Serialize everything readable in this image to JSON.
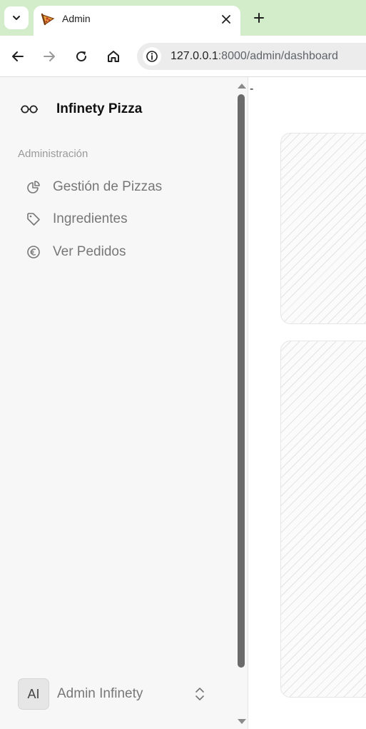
{
  "browser": {
    "tab_title": "Admin",
    "url_host": "127.0.0.1",
    "url_rest": ":8000/admin/dashboard",
    "icons": [
      "chevron-down-icon",
      "pizza-favicon",
      "close-icon",
      "plus-icon",
      "back-icon",
      "forward-icon",
      "reload-icon",
      "home-icon",
      "info-icon"
    ]
  },
  "sidebar": {
    "brand": "Infinety Pizza",
    "section_label": "Administración",
    "items": [
      {
        "label": "Gestión de Pizzas",
        "icon": "pie-chart-icon"
      },
      {
        "label": "Ingredientes",
        "icon": "tag-icon"
      },
      {
        "label": "Ver Pedidos",
        "icon": "euro-icon"
      }
    ],
    "user": {
      "initials": "AI",
      "name": "Admin Infinety"
    }
  },
  "main": {
    "dash": "-"
  },
  "colors": {
    "tabstrip": "#d3ecc9",
    "sidebar_bg": "#f7f7f7",
    "nav_text": "#777777"
  }
}
